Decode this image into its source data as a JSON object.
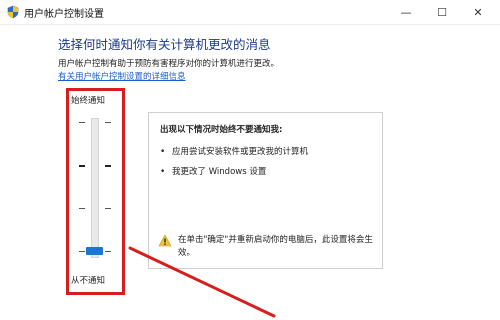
{
  "window": {
    "title": "用户帐户控制设置",
    "minimize_glyph": "—",
    "maximize_glyph": "☐",
    "close_glyph": "✕"
  },
  "main": {
    "heading": "选择何时通知你有关计算机更改的消息",
    "description": "用户帐户控制有助于预防有害程序对你的计算机进行更改。",
    "more_link": "有关用户帐户控制设置的详细信息"
  },
  "slider": {
    "top_label": "始终通知",
    "bottom_label": "从不通知",
    "levels": 4,
    "selected_level": 1,
    "selected_position": "bottom"
  },
  "info_panel": {
    "title": "出现以下情况时始终不要通知我:",
    "bullets": [
      "应用尝试安装软件或更改我的计算机",
      "我更改了 Windows 设置"
    ],
    "warning": "在单击\"确定\"并重新启动你的电脑后，此设置将会生效。"
  },
  "colors": {
    "heading": "#1e3b8a",
    "link": "#1a5fd0",
    "highlight": "#d71e1e",
    "thumb": "#1976d2",
    "warning": "#f2c230"
  },
  "icons": {
    "app": "uac-shield-icon",
    "warning": "warning-triangle-icon"
  }
}
